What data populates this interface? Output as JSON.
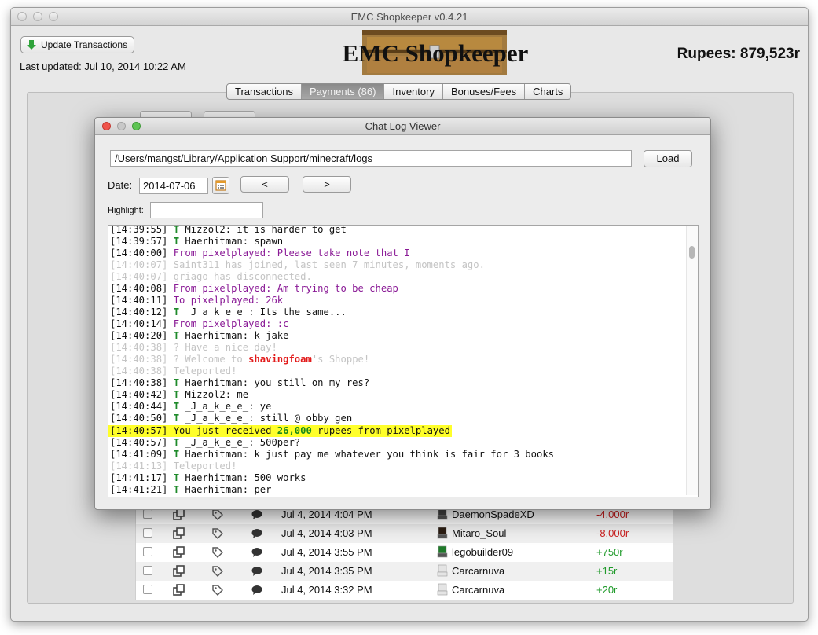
{
  "window": {
    "title": "EMC Shopkeeper v0.4.21"
  },
  "header": {
    "update_label": "Update Transactions",
    "last_updated": "Last updated: Jul 10, 2014 10:22 AM",
    "app_name": "EMC Shopkeeper",
    "rupees": "Rupees:  879,523r"
  },
  "tabs": [
    {
      "label": "Transactions"
    },
    {
      "label": "Payments (86)",
      "active": true
    },
    {
      "label": "Inventory"
    },
    {
      "label": "Bonuses/Fees"
    },
    {
      "label": "Charts"
    }
  ],
  "payments": [
    {
      "date": "Jul 4, 2014 4:04 PM",
      "player": "DaemonSpadeXD",
      "amount": "-4,000r",
      "sign": "neg"
    },
    {
      "date": "Jul 4, 2014 4:03 PM",
      "player": "Mitaro_Soul",
      "amount": "-8,000r",
      "sign": "neg"
    },
    {
      "date": "Jul 4, 2014 3:55 PM",
      "player": "legobuilder09",
      "amount": "+750r",
      "sign": "pos"
    },
    {
      "date": "Jul 4, 2014 3:35 PM",
      "player": "Carcarnuva",
      "amount": "+15r",
      "sign": "pos"
    },
    {
      "date": "Jul 4, 2014 3:32 PM",
      "player": "Carcarnuva",
      "amount": "+20r",
      "sign": "pos"
    }
  ],
  "dialog": {
    "title": "Chat Log Viewer",
    "path": "/Users/mangst/Library/Application Support/minecraft/logs",
    "load_label": "Load",
    "date_label": "Date:",
    "date_value": "2014-07-06",
    "prev_label": "<",
    "next_label": ">",
    "highlight_label": "Highlight:",
    "highlight_value": ""
  },
  "chat_log": [
    {
      "ts": "[14:39:55]",
      "tag": "T",
      "text": " Mizzol2: it is harder to get",
      "style": "normal"
    },
    {
      "ts": "[14:39:57]",
      "tag": "T",
      "text": " Haerhitman: spawn",
      "style": "normal"
    },
    {
      "ts": "[14:40:00]",
      "text": " From pixelplayed: Please take note that I",
      "style": "pm"
    },
    {
      "ts": "[14:40:07]",
      "text": " Saint311 has joined, last seen 7 minutes, moments ago.",
      "style": "fade"
    },
    {
      "ts": "[14:40:07]",
      "text": " griago has disconnected.",
      "style": "fade"
    },
    {
      "ts": "[14:40:08]",
      "text": " From pixelplayed: Am trying to be cheap",
      "style": "pm"
    },
    {
      "ts": "[14:40:11]",
      "text": " To pixelplayed: 26k",
      "style": "pm"
    },
    {
      "ts": "[14:40:12]",
      "tag": "T",
      "text": " _J_a_k_e_e_: Its the same...",
      "style": "normal"
    },
    {
      "ts": "[14:40:14]",
      "text": " From pixelplayed: :c",
      "style": "pm"
    },
    {
      "ts": "[14:40:20]",
      "tag": "T",
      "text": " Haerhitman: k jake",
      "style": "normal"
    },
    {
      "ts": "[14:40:38]",
      "text": " ? Have a nice day!",
      "style": "fade"
    },
    {
      "ts": "[14:40:38]",
      "text": " ? Welcome to ",
      "red": "shavingfoam",
      "after": "'s Shoppe!",
      "style": "fade"
    },
    {
      "ts": "[14:40:38]",
      "text": " Teleported!",
      "style": "fade"
    },
    {
      "ts": "[14:40:38]",
      "tag": "T",
      "text": " Haerhitman: you still on my res?",
      "style": "normal"
    },
    {
      "ts": "[14:40:42]",
      "tag": "T",
      "text": " Mizzol2: me",
      "style": "normal"
    },
    {
      "ts": "[14:40:44]",
      "tag": "T",
      "text": " _J_a_k_e_e_: ye",
      "style": "normal"
    },
    {
      "ts": "[14:40:50]",
      "tag": "T",
      "text": " _J_a_k_e_e_: still @ obby gen",
      "style": "normal"
    },
    {
      "ts": "[14:40:57]",
      "text": " You just received ",
      "green": "26,000",
      "after": " rupees from pixelplayed",
      "style": "hl"
    },
    {
      "ts": "[14:40:57]",
      "tag": "T",
      "text": " _J_a_k_e_e_: 500per?",
      "style": "normal"
    },
    {
      "ts": "[14:41:09]",
      "tag": "T",
      "text": " Haerhitman: k just pay me whatever you think is fair for 3 books",
      "style": "normal"
    },
    {
      "ts": "[14:41:13]",
      "text": " Teleported!",
      "style": "fade"
    },
    {
      "ts": "[14:41:17]",
      "tag": "T",
      "text": " Haerhitman: 500 works",
      "style": "normal"
    },
    {
      "ts": "[14:41:21]",
      "tag": "T",
      "text": " Haerhitman: per",
      "style": "normal"
    }
  ],
  "colors": {
    "pm": "#8a1a96",
    "faded": "#c4c4c4",
    "highlight": "#ffff2a",
    "negative": "#cc1f1f",
    "positive": "#1f9a2a"
  }
}
